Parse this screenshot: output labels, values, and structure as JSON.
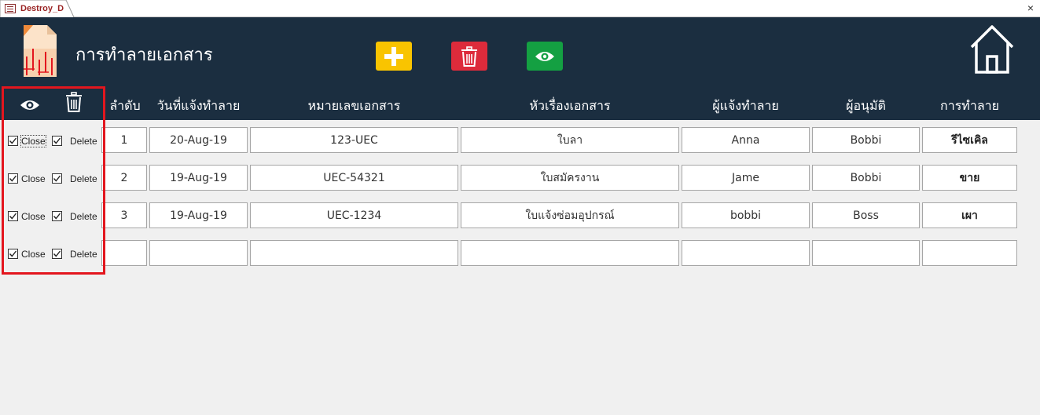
{
  "window": {
    "tab_title": "Destroy_D",
    "close_glyph": "×"
  },
  "header": {
    "title": "การทำลายเอกสาร",
    "add_icon": "plus-icon",
    "delete_icon": "trash-icon",
    "view_icon": "eye-icon",
    "home_icon": "home-icon"
  },
  "colors": {
    "header_bg": "#1b2e40",
    "add_button": "#f9c400",
    "delete_button": "#dd2b3b",
    "view_button": "#14a042",
    "highlight": "#e3161e"
  },
  "columns": {
    "view": "eye-icon",
    "delete": "trash-icon",
    "no": "ลำดับ",
    "date": "วันที่แจ้งทำลาย",
    "doc_no": "หมายเลขเอกสาร",
    "subject": "หัวเรื่องเอกสาร",
    "reporter": "ผู้แจ้งทำลาย",
    "approver": "ผู้อนุมัติ",
    "method": "การทำลาย"
  },
  "rows": [
    {
      "close_label": "Close",
      "close_checked": true,
      "delete_label": "Delete",
      "delete_checked": true,
      "no": "1",
      "date": "20-Aug-19",
      "doc_no": "123-UEC",
      "subject": "ใบลา",
      "reporter": "Anna",
      "approver": "Bobbi",
      "method": "รีไซเคิล"
    },
    {
      "close_label": "Close",
      "close_checked": true,
      "delete_label": "Delete",
      "delete_checked": true,
      "no": "2",
      "date": "19-Aug-19",
      "doc_no": "UEC-54321",
      "subject": "ใบสมัครงาน",
      "reporter": "Jame",
      "approver": "Bobbi",
      "method": "ขาย"
    },
    {
      "close_label": "Close",
      "close_checked": true,
      "delete_label": "Delete",
      "delete_checked": true,
      "no": "3",
      "date": "19-Aug-19",
      "doc_no": "UEC-1234",
      "subject": "ใบแจ้งซ่อมอุปกรณ์",
      "reporter": "bobbi",
      "approver": "Boss",
      "method": "เผา"
    },
    {
      "close_label": "Close",
      "close_checked": true,
      "delete_label": "Delete",
      "delete_checked": true,
      "no": "",
      "date": "",
      "doc_no": "",
      "subject": "",
      "reporter": "",
      "approver": "",
      "method": ""
    }
  ]
}
